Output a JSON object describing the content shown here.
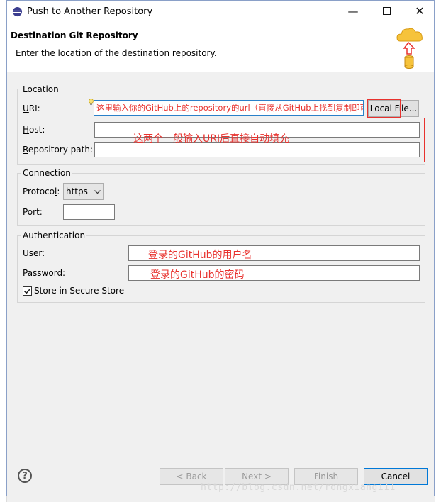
{
  "window": {
    "title": "Push to Another Repository"
  },
  "header": {
    "title": "Destination Git Repository",
    "description": "Enter the location of the destination repository."
  },
  "location": {
    "group_label": "Location",
    "uri_label": "URI:",
    "uri_value": "这里输入你的GitHub上的repository的url（直接从GitHub上找到复制即可）",
    "local_file_button": "Local File...",
    "host_label": "Host:",
    "host_value": "",
    "repo_path_label": "Repository path:",
    "repo_path_value": "",
    "annotation": "这两个一般输入URI后直接自动填充"
  },
  "connection": {
    "group_label": "Connection",
    "protocol_label": "Protocol:",
    "protocol_value": "https",
    "port_label": "Port:",
    "port_value": ""
  },
  "authentication": {
    "group_label": "Authentication",
    "user_label": "User:",
    "user_annotation": "登录的GitHub的用户名",
    "password_label": "Password:",
    "password_annotation": "登录的GitHub的密码",
    "store_label": "Store in Secure Store",
    "store_checked": true
  },
  "footer": {
    "back_label": "< Back",
    "next_label": "Next >",
    "finish_label": "Finish",
    "cancel_label": "Cancel"
  },
  "watermark": "http://blog.csdn.net/rongxiang111",
  "colors": {
    "annotation_red": "#e8322e",
    "focus_blue": "#0078d7"
  }
}
